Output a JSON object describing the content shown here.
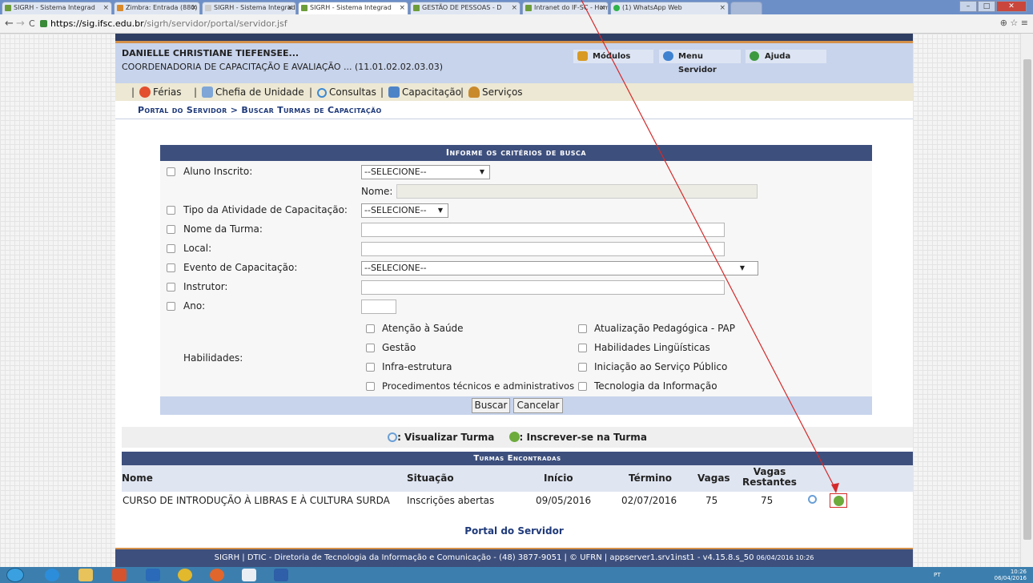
{
  "browser": {
    "tabs": [
      {
        "label": "SIGRH - Sistema Integrad",
        "active": false
      },
      {
        "label": "Zimbra: Entrada (880)",
        "active": false
      },
      {
        "label": "SIGRH - Sistema Integrad",
        "active": false
      },
      {
        "label": "SIGRH - Sistema Integrad",
        "active": true
      },
      {
        "label": "GESTÃO DE PESSOAS - D",
        "active": false
      },
      {
        "label": "Intranet do IF-SC - Home",
        "active": false
      },
      {
        "label": "(1) WhatsApp Web",
        "active": false
      }
    ],
    "url_host": "https://sig.ifsc.edu.br",
    "url_path": "/sigrh/servidor/portal/servidor.jsf"
  },
  "user": {
    "name": "DANIELLE CHRISTIANE TIEFENSEE...",
    "dept": "COORDENADORIA DE CAPACITAÇÃO E AVALIAÇÃO ... (11.01.02.02.03.03)"
  },
  "userbar": {
    "modulos": "Módulos",
    "menu_servidor": "Menu Servidor",
    "ajuda": "Ajuda"
  },
  "menu": {
    "ferias": "Férias",
    "chefia": "Chefia de Unidade",
    "consultas": "Consultas",
    "capacitacao": "Capacitação",
    "servicos": "Serviços"
  },
  "breadcrumb": "Portal do Servidor > Buscar Turmas de Capacitação",
  "form": {
    "title": "Informe os critérios de busca",
    "aluno_label": "Aluno Inscrito:",
    "aluno_value": "--SELECIONE--",
    "nome_label": "Nome:",
    "tipo_label": "Tipo da Atividade de Capacitação:",
    "tipo_value": "--SELECIONE--",
    "turma_label": "Nome da Turma:",
    "local_label": "Local:",
    "evento_label": "Evento de Capacitação:",
    "evento_value": "--SELECIONE--",
    "instrutor_label": "Instrutor:",
    "ano_label": "Ano:",
    "habilidades_label": "Habilidades:",
    "habilidades": [
      "Atenção à Saúde",
      "Atualização Pedagógica - PAP",
      "Gestão",
      "Habilidades Lingüísticas",
      "Infra-estrutura",
      "Iniciação ao Serviço Público",
      "Procedimentos técnicos e administrativos",
      "Tecnologia da Informação"
    ],
    "buscar": "Buscar",
    "cancelar": "Cancelar"
  },
  "legend": {
    "view": ": Visualizar Turma",
    "enroll": ": Inscrever-se na Turma"
  },
  "results": {
    "title": "Turmas Encontradas",
    "headers": [
      "Nome",
      "Situação",
      "Início",
      "Término",
      "Vagas",
      "Vagas Restantes"
    ],
    "rows": [
      [
        "CURSO DE INTRODUÇÃO À LIBRAS E À CULTURA SURDA",
        "Inscrições abertas",
        "09/05/2016",
        "02/07/2016",
        "75",
        "75"
      ]
    ]
  },
  "portal_link": "Portal do Servidor",
  "footer": {
    "text": "SIGRH | DTIC - Diretoria de Tecnologia da Informação e Comunicação - (48) 3877-9051 | © UFRN | appserver1.srv1inst1 - v4.15.8.s_50",
    "date": "06/04/2016 10:26"
  },
  "taskbar": {
    "lang": "PT",
    "time": "10:26",
    "date": "06/04/2016"
  },
  "colors": {
    "header_navy": "#3d4f7d",
    "user_bar": "#c8d4ec",
    "accent_orange": "#d4914a",
    "link_blue": "#1f3a7a",
    "annotation_red": "#d42a2a"
  }
}
